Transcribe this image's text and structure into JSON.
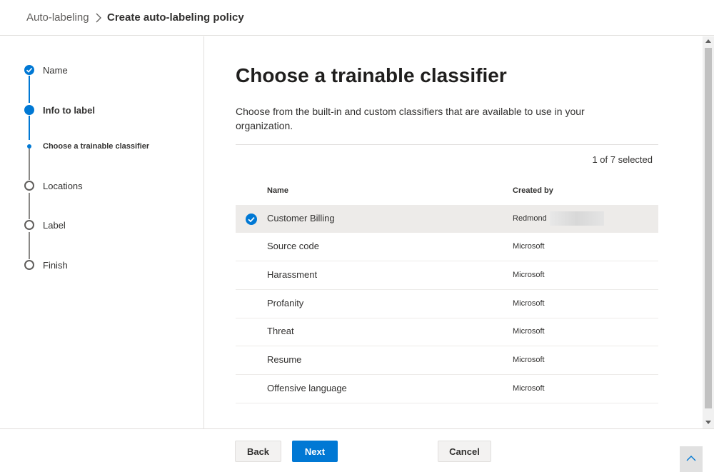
{
  "breadcrumb": {
    "parent": "Auto-labeling",
    "current": "Create auto-labeling policy"
  },
  "wizard": {
    "steps": [
      {
        "label": "Name",
        "state": "done"
      },
      {
        "label": "Info to label",
        "state": "current"
      },
      {
        "label": "Choose a trainable classifier",
        "state": "current-sub"
      },
      {
        "label": "Locations",
        "state": "pending"
      },
      {
        "label": "Label",
        "state": "pending"
      },
      {
        "label": "Finish",
        "state": "pending"
      }
    ]
  },
  "main": {
    "title": "Choose a trainable classifier",
    "description": "Choose from the built-in and custom classifiers that are available to use in your organization.",
    "selection_count": "1 of 7 selected",
    "columns": {
      "name": "Name",
      "created_by": "Created by"
    },
    "rows": [
      {
        "name": "Customer Billing",
        "created_by": "Redmond",
        "selected": true
      },
      {
        "name": "Source code",
        "created_by": "Microsoft",
        "selected": false
      },
      {
        "name": "Harassment",
        "created_by": "Microsoft",
        "selected": false
      },
      {
        "name": "Profanity",
        "created_by": "Microsoft",
        "selected": false
      },
      {
        "name": "Threat",
        "created_by": "Microsoft",
        "selected": false
      },
      {
        "name": "Resume",
        "created_by": "Microsoft",
        "selected": false
      },
      {
        "name": "Offensive language",
        "created_by": "Microsoft",
        "selected": false
      }
    ]
  },
  "footer": {
    "back_label": "Back",
    "next_label": "Next",
    "cancel_label": "Cancel"
  },
  "colors": {
    "accent": "#0078d4",
    "selected_row": "#edebe9"
  },
  "icons": {
    "breadcrumb_separator": "chevron-right-icon",
    "step_done": "checkmark-circle-icon",
    "row_selected": "checkmark-circle-icon",
    "scroll_top": "chevron-up-icon"
  }
}
